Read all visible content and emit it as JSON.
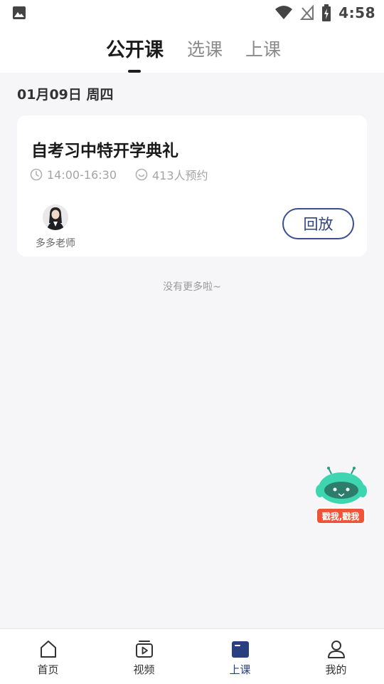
{
  "status_bar": {
    "time": "4:58",
    "icons": [
      "gallery-icon",
      "wifi-icon",
      "no-signal-icon",
      "battery-charging-icon"
    ]
  },
  "header": {
    "tabs": [
      {
        "label": "公开课",
        "active": true
      },
      {
        "label": "选课",
        "active": false
      },
      {
        "label": "上课",
        "active": false
      }
    ]
  },
  "schedule": {
    "date": "01月09日 周四",
    "course": {
      "title": "自考习中特开学典礼",
      "time": "14:00-16:30",
      "reservations": "413人预约",
      "teacher": "多多老师",
      "action_label": "回放"
    },
    "end_text": "没有更多啦~"
  },
  "mascot": {
    "label": "戳我,戳我"
  },
  "bottom_nav": {
    "items": [
      {
        "label": "首页",
        "icon": "home-icon",
        "active": false
      },
      {
        "label": "视频",
        "icon": "video-icon",
        "active": false
      },
      {
        "label": "上课",
        "icon": "class-icon",
        "active": true
      },
      {
        "label": "我的",
        "icon": "profile-icon",
        "active": false
      }
    ]
  },
  "colors": {
    "accent": "#2a3f80",
    "background": "#f6f6f9",
    "mascot_badge": "#f0523a",
    "mascot_body": "#3ed6b0"
  }
}
